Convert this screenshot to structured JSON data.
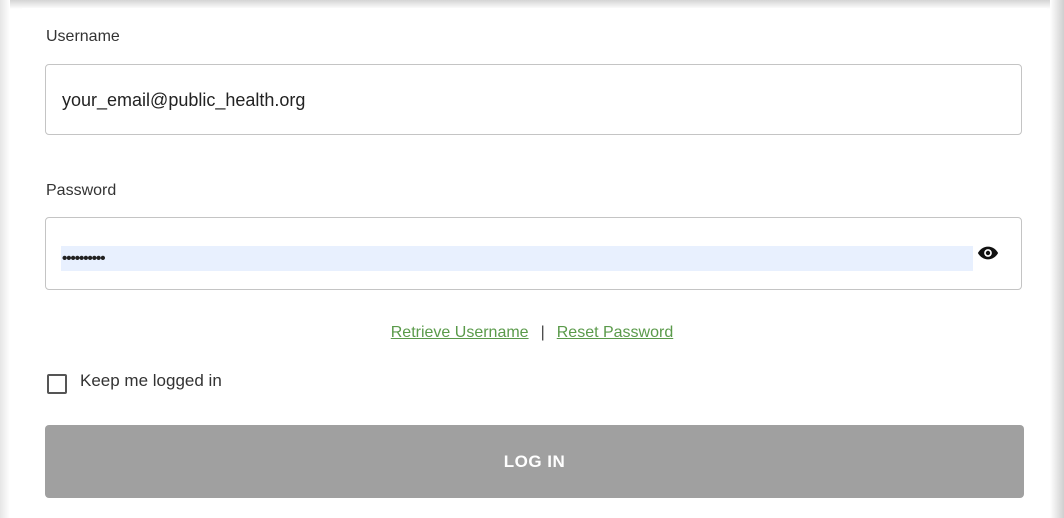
{
  "form": {
    "username_label": "Username",
    "username_value": "your_email@public_health.org",
    "password_label": "Password",
    "password_value": "••••••••••",
    "show_password_icon": "eye-icon",
    "retrieve_username_link": "Retrieve Username",
    "link_separator": "|",
    "reset_password_link": "Reset Password",
    "keep_logged_in_label": "Keep me logged in",
    "keep_logged_in_checked": false,
    "login_button_label": "LOG IN"
  },
  "colors": {
    "link": "#5a9a4a",
    "button_bg": "#a0a0a0",
    "autofill_bg": "#e8f0fe",
    "input_border": "#c4c4c4"
  }
}
